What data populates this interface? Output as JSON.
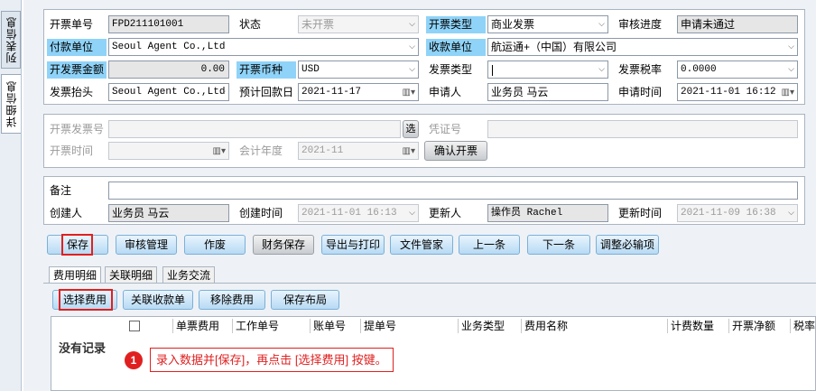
{
  "side_tabs": {
    "list": "列表信息",
    "detail": "详细信息"
  },
  "form": {
    "invoice_no": {
      "label": "开票单号",
      "value": "FPD211101001"
    },
    "status": {
      "label": "状态",
      "value": "未开票"
    },
    "invoice_type": {
      "label": "开票类型",
      "value": "商业发票"
    },
    "audit_progress": {
      "label": "审核进度",
      "value": "申请未通过"
    },
    "payer": {
      "label": "付款单位",
      "value": "Seoul Agent Co.,Ltd"
    },
    "payee": {
      "label": "收款单位",
      "value": "航运通+（中国）有限公司"
    },
    "amount": {
      "label": "开发票金额",
      "value": "0.00"
    },
    "currency": {
      "label": "开票币种",
      "value": "USD"
    },
    "fapiao_type": {
      "label": "发票类型",
      "value": ""
    },
    "tax_rate": {
      "label": "发票税率",
      "value": "0.0000"
    },
    "header": {
      "label": "发票抬头",
      "value": "Seoul Agent Co.,Ltd"
    },
    "expected_date": {
      "label": "预计回款日",
      "value": "2021-11-17"
    },
    "applicant": {
      "label": "申请人",
      "value": "业务员 马云"
    },
    "apply_time": {
      "label": "申请时间",
      "value": "2021-11-01 16:12"
    },
    "issued_no": {
      "label": "开票发票号",
      "value": "",
      "select_btn": "选"
    },
    "voucher_no": {
      "label": "凭证号",
      "value": ""
    },
    "issue_time": {
      "label": "开票时间",
      "value": ""
    },
    "fiscal_year": {
      "label": "会计年度",
      "value": "2021-11"
    },
    "confirm_btn": "确认开票",
    "remark": {
      "label": "备注",
      "value": ""
    },
    "creator": {
      "label": "创建人",
      "value": "业务员 马云"
    },
    "create_time": {
      "label": "创建时间",
      "value": "2021-11-01 16:13"
    },
    "updater": {
      "label": "更新人",
      "value": "操作员 Rachel"
    },
    "update_time": {
      "label": "更新时间",
      "value": "2021-11-09 16:38"
    }
  },
  "toolbar": {
    "save": "保存",
    "audit": "审核管理",
    "void": "作废",
    "finance_save": "财务保存",
    "export_print": "导出与打印",
    "files": "文件管家",
    "prev": "上一条",
    "next": "下一条",
    "adjust": "调整必输项"
  },
  "tabs": {
    "fees": "费用明细",
    "related": "关联明细",
    "comm": "业务交流"
  },
  "subtoolbar": {
    "select_fee": "选择费用",
    "link_receipt": "关联收款单",
    "remove_fee": "移除费用",
    "save_layout": "保存布局"
  },
  "grid": {
    "columns": [
      "单票费用",
      "工作单号",
      "账单号",
      "提单号",
      "业务类型",
      "费用名称",
      "计费数量",
      "开票净额",
      "税率"
    ],
    "empty_text": "没有记录"
  },
  "callout": {
    "number": "1",
    "text": "录入数据并[保存]，再点击 [选择费用] 按键。"
  },
  "colors": {
    "label_highlight": "#8fd3f8",
    "button": "#b7daf4",
    "callout": "#e02020"
  }
}
